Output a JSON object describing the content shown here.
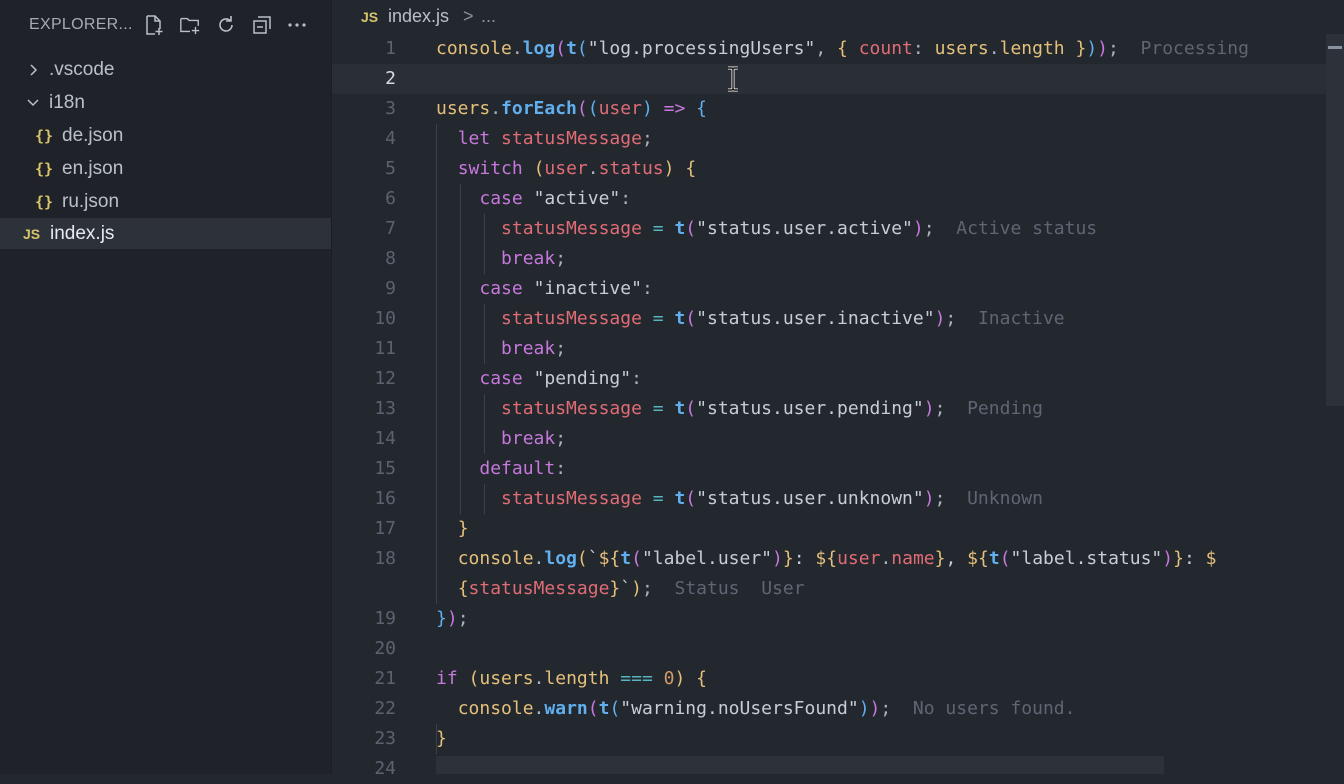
{
  "sidebar": {
    "title": "EXPLORER...",
    "header_icons": [
      "new-file-icon",
      "new-folder-icon",
      "refresh-icon",
      "collapse-all-icon",
      "more-icon"
    ],
    "tree": [
      {
        "label": ".vscode",
        "type": "folder",
        "expanded": false
      },
      {
        "label": "i18n",
        "type": "folder",
        "expanded": true
      },
      {
        "label": "de.json",
        "type": "json",
        "icon_glyph": "{}"
      },
      {
        "label": "en.json",
        "type": "json",
        "icon_glyph": "{}"
      },
      {
        "label": "ru.json",
        "type": "json",
        "icon_glyph": "{}"
      },
      {
        "label": "index.js",
        "type": "js",
        "icon_glyph": "JS",
        "selected": true
      }
    ]
  },
  "breadcrumb": {
    "icon": "JS",
    "file": "index.js",
    "separator": ">",
    "more": "..."
  },
  "editor": {
    "current_line": "2",
    "line_numbers": [
      "1",
      "2",
      "3",
      "4",
      "5",
      "6",
      "7",
      "8",
      "9",
      "10",
      "11",
      "12",
      "13",
      "14",
      "15",
      "16",
      "17",
      "18",
      "",
      "19",
      "20",
      "21",
      "22",
      "23",
      "24"
    ],
    "inline_hints": {
      "l1": "Processing",
      "l7": "Active status",
      "l10": "Inactive",
      "l13": "Pending",
      "l16": "Unknown",
      "l18a": "Status",
      "l18b": "User",
      "l22": "No users found."
    }
  },
  "colors": {
    "keyword": "#c678dd",
    "function": "#61afef",
    "object": "#e5c07b",
    "variable": "#e06c75",
    "number": "#d19a66",
    "hint": "#5f6672"
  }
}
